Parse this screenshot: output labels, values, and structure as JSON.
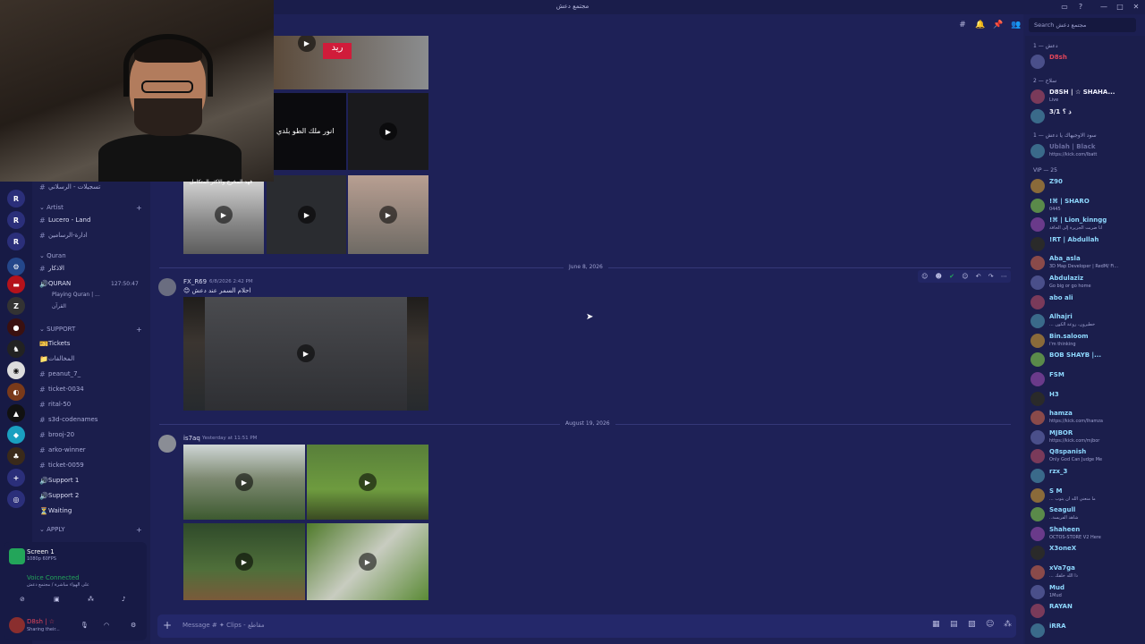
{
  "window": {
    "title": "مجتمع دعش"
  },
  "search": {
    "placeholder": "Search مجتمع دعش"
  },
  "channels": {
    "top": [
      "تسجيلات - الرسلاني"
    ],
    "cat_artist": "Artist",
    "artist_items": [
      "Lucero - Land",
      "ادارة-الرسامين"
    ],
    "cat_quran": "Quran",
    "quran_items": [
      "الاذكار"
    ],
    "voice_quran": {
      "name": "QURAN",
      "time": "127:50:47",
      "status": "Playing Quran | ...",
      "sub": "القرآن"
    },
    "cat_support": "SUPPORT",
    "support_items": [
      "Tickets",
      "المخالفات",
      "peanut_7_",
      "ticket-0034",
      "rital-50",
      "s3d-codenames",
      "brooj-20",
      "arko-winner",
      "ticket-0059",
      "Support 1",
      "Support 2",
      "Waiting"
    ],
    "cat_apply": "APPLY"
  },
  "messages": [
    {
      "date": "June 8, 2026",
      "user": "FX_R69",
      "time": "6/8/2026 2:42 PM",
      "text": "احلام السمر عند دعش"
    },
    {
      "date": "August 19, 2026",
      "user": "is7aq",
      "time": "Yesterday at 11:51 PM",
      "text": ""
    }
  ],
  "webcam_caption": "فهد المخرج والاكثر المتكامل",
  "media_caption": "انور ملك الطو بلدي",
  "composer": {
    "placeholder": "Message # ✦ Clips - مقاطع"
  },
  "user_panel": {
    "screen": "Screen 1",
    "screen_sub": "1080p 60FPS",
    "voice": "Voice Connected",
    "voice_sub": "على الهواء مباشرة / مجتمع دعش",
    "user": "D8sh | ☆",
    "user_sub": "Sharing their..."
  },
  "member_groups": [
    {
      "label": "دعش — 1",
      "members": [
        {
          "name": "D8sh",
          "status": "",
          "color": "#e0455a"
        }
      ]
    },
    {
      "label": "سلاح — 2",
      "members": [
        {
          "name": "D8SH | ☆ SHAHA...",
          "status": "Live",
          "color": "#f2f3ff"
        },
        {
          "name": "ذ ؟ 3/1",
          "status": "",
          "color": "#f2f3ff"
        }
      ]
    },
    {
      "label": "سود الاوجيهاك يا دعش — 1",
      "members": [
        {
          "name": "Ublah | Black",
          "status": "https://kick.com/lbatt",
          "color": "#6a6da0"
        }
      ]
    },
    {
      "label": "VIP — 25",
      "members": [
        {
          "name": "Z90",
          "status": "",
          "color": "#8fd9ff"
        },
        {
          "name": "!⌘ | SHARO",
          "status": "0445",
          "color": "#8fd9ff"
        },
        {
          "name": "!⌘ | Lion_kinngg",
          "status": "انا ضربت الجزيرة إلى الحافة",
          "color": "#8fd9ff"
        },
        {
          "name": "!RT | Abdullah",
          "status": "",
          "color": "#8fd9ff"
        },
        {
          "name": "Aba_asla",
          "status": "3D Map Developer | RedM/ Fi...",
          "color": "#8fd9ff"
        },
        {
          "name": "Abdulaziz",
          "status": "Go big or go home",
          "color": "#8fd9ff"
        },
        {
          "name": "abo ali",
          "status": "",
          "color": "#8fd9ff"
        },
        {
          "name": "Alhajri",
          "status": "... خطيرون، روعة الكون",
          "color": "#8fd9ff"
        },
        {
          "name": "Bin.saloom",
          "status": "i'm thinking",
          "color": "#8fd9ff"
        },
        {
          "name": "BOB SHAYB |...",
          "status": "",
          "color": "#8fd9ff"
        },
        {
          "name": "FSM",
          "status": "",
          "color": "#8fd9ff"
        },
        {
          "name": "H3",
          "status": "",
          "color": "#8fd9ff"
        },
        {
          "name": "hamza",
          "status": "https://kick.com/lhamza",
          "color": "#8fd9ff"
        },
        {
          "name": "MJBOR",
          "status": "https://kick.com/mjbor",
          "color": "#8fd9ff"
        },
        {
          "name": "Q8spanish",
          "status": "Only God Can Judge Me",
          "color": "#8fd9ff"
        },
        {
          "name": "rzx_3",
          "status": "",
          "color": "#8fd9ff"
        },
        {
          "name": "S M",
          "status": "... ما منعني الله ان يتوب",
          "color": "#8fd9ff"
        },
        {
          "name": "Seagull",
          "status": "..شاهد الفريسة",
          "color": "#8fd9ff"
        },
        {
          "name": "Shaheen",
          "status": "OCTOS-STORE V2 Here",
          "color": "#8fd9ff"
        },
        {
          "name": "X3oneX",
          "status": "",
          "color": "#8fd9ff"
        },
        {
          "name": "xVa7ga",
          "status": "... ذا الله خلقك",
          "color": "#8fd9ff"
        },
        {
          "name": "Mud",
          "status": "1Mud",
          "color": "#8fd9ff"
        },
        {
          "name": "RAYAN",
          "status": "",
          "color": "#8fd9ff"
        },
        {
          "name": "iRRA",
          "status": "",
          "color": "#8fd9ff"
        }
      ]
    }
  ]
}
